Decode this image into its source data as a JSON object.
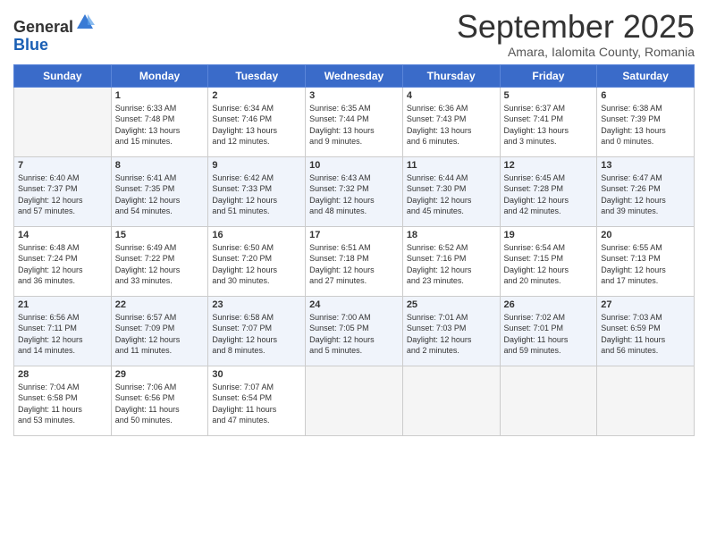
{
  "logo": {
    "general": "General",
    "blue": "Blue"
  },
  "title": "September 2025",
  "subtitle": "Amara, Ialomita County, Romania",
  "days_header": [
    "Sunday",
    "Monday",
    "Tuesday",
    "Wednesday",
    "Thursday",
    "Friday",
    "Saturday"
  ],
  "weeks": [
    {
      "days": [
        {
          "num": "",
          "info": ""
        },
        {
          "num": "1",
          "info": "Sunrise: 6:33 AM\nSunset: 7:48 PM\nDaylight: 13 hours\nand 15 minutes."
        },
        {
          "num": "2",
          "info": "Sunrise: 6:34 AM\nSunset: 7:46 PM\nDaylight: 13 hours\nand 12 minutes."
        },
        {
          "num": "3",
          "info": "Sunrise: 6:35 AM\nSunset: 7:44 PM\nDaylight: 13 hours\nand 9 minutes."
        },
        {
          "num": "4",
          "info": "Sunrise: 6:36 AM\nSunset: 7:43 PM\nDaylight: 13 hours\nand 6 minutes."
        },
        {
          "num": "5",
          "info": "Sunrise: 6:37 AM\nSunset: 7:41 PM\nDaylight: 13 hours\nand 3 minutes."
        },
        {
          "num": "6",
          "info": "Sunrise: 6:38 AM\nSunset: 7:39 PM\nDaylight: 13 hours\nand 0 minutes."
        }
      ]
    },
    {
      "days": [
        {
          "num": "7",
          "info": "Sunrise: 6:40 AM\nSunset: 7:37 PM\nDaylight: 12 hours\nand 57 minutes."
        },
        {
          "num": "8",
          "info": "Sunrise: 6:41 AM\nSunset: 7:35 PM\nDaylight: 12 hours\nand 54 minutes."
        },
        {
          "num": "9",
          "info": "Sunrise: 6:42 AM\nSunset: 7:33 PM\nDaylight: 12 hours\nand 51 minutes."
        },
        {
          "num": "10",
          "info": "Sunrise: 6:43 AM\nSunset: 7:32 PM\nDaylight: 12 hours\nand 48 minutes."
        },
        {
          "num": "11",
          "info": "Sunrise: 6:44 AM\nSunset: 7:30 PM\nDaylight: 12 hours\nand 45 minutes."
        },
        {
          "num": "12",
          "info": "Sunrise: 6:45 AM\nSunset: 7:28 PM\nDaylight: 12 hours\nand 42 minutes."
        },
        {
          "num": "13",
          "info": "Sunrise: 6:47 AM\nSunset: 7:26 PM\nDaylight: 12 hours\nand 39 minutes."
        }
      ]
    },
    {
      "days": [
        {
          "num": "14",
          "info": "Sunrise: 6:48 AM\nSunset: 7:24 PM\nDaylight: 12 hours\nand 36 minutes."
        },
        {
          "num": "15",
          "info": "Sunrise: 6:49 AM\nSunset: 7:22 PM\nDaylight: 12 hours\nand 33 minutes."
        },
        {
          "num": "16",
          "info": "Sunrise: 6:50 AM\nSunset: 7:20 PM\nDaylight: 12 hours\nand 30 minutes."
        },
        {
          "num": "17",
          "info": "Sunrise: 6:51 AM\nSunset: 7:18 PM\nDaylight: 12 hours\nand 27 minutes."
        },
        {
          "num": "18",
          "info": "Sunrise: 6:52 AM\nSunset: 7:16 PM\nDaylight: 12 hours\nand 23 minutes."
        },
        {
          "num": "19",
          "info": "Sunrise: 6:54 AM\nSunset: 7:15 PM\nDaylight: 12 hours\nand 20 minutes."
        },
        {
          "num": "20",
          "info": "Sunrise: 6:55 AM\nSunset: 7:13 PM\nDaylight: 12 hours\nand 17 minutes."
        }
      ]
    },
    {
      "days": [
        {
          "num": "21",
          "info": "Sunrise: 6:56 AM\nSunset: 7:11 PM\nDaylight: 12 hours\nand 14 minutes."
        },
        {
          "num": "22",
          "info": "Sunrise: 6:57 AM\nSunset: 7:09 PM\nDaylight: 12 hours\nand 11 minutes."
        },
        {
          "num": "23",
          "info": "Sunrise: 6:58 AM\nSunset: 7:07 PM\nDaylight: 12 hours\nand 8 minutes."
        },
        {
          "num": "24",
          "info": "Sunrise: 7:00 AM\nSunset: 7:05 PM\nDaylight: 12 hours\nand 5 minutes."
        },
        {
          "num": "25",
          "info": "Sunrise: 7:01 AM\nSunset: 7:03 PM\nDaylight: 12 hours\nand 2 minutes."
        },
        {
          "num": "26",
          "info": "Sunrise: 7:02 AM\nSunset: 7:01 PM\nDaylight: 11 hours\nand 59 minutes."
        },
        {
          "num": "27",
          "info": "Sunrise: 7:03 AM\nSunset: 6:59 PM\nDaylight: 11 hours\nand 56 minutes."
        }
      ]
    },
    {
      "days": [
        {
          "num": "28",
          "info": "Sunrise: 7:04 AM\nSunset: 6:58 PM\nDaylight: 11 hours\nand 53 minutes."
        },
        {
          "num": "29",
          "info": "Sunrise: 7:06 AM\nSunset: 6:56 PM\nDaylight: 11 hours\nand 50 minutes."
        },
        {
          "num": "30",
          "info": "Sunrise: 7:07 AM\nSunset: 6:54 PM\nDaylight: 11 hours\nand 47 minutes."
        },
        {
          "num": "",
          "info": ""
        },
        {
          "num": "",
          "info": ""
        },
        {
          "num": "",
          "info": ""
        },
        {
          "num": "",
          "info": ""
        }
      ]
    }
  ]
}
